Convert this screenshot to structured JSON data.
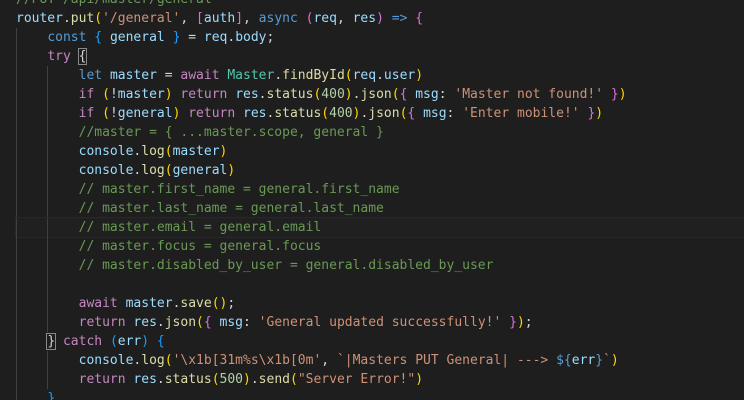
{
  "editor": {
    "language": "javascript",
    "theme_colors": {
      "background": "#1e1e1e",
      "keyword": "#569cd6",
      "control": "#c586c0",
      "function": "#dcdcaa",
      "variable": "#9cdcfe",
      "class": "#4ec9b0",
      "string": "#ce9178",
      "number": "#b5cea8",
      "comment": "#6a9955",
      "bracket_1": "#ffd700",
      "bracket_2": "#da70d6",
      "bracket_3": "#179fff"
    },
    "lines": [
      {
        "indent": 0,
        "current": false,
        "tokens": [
          [
            "com",
            "//PUT /api/master/general"
          ]
        ]
      },
      {
        "indent": 0,
        "current": false,
        "tokens": [
          [
            "var",
            "router"
          ],
          [
            "pun",
            "."
          ],
          [
            "fn",
            "put"
          ],
          [
            "br1",
            "("
          ],
          [
            "str",
            "'/general'"
          ],
          [
            "pun",
            ", "
          ],
          [
            "br2",
            "["
          ],
          [
            "var",
            "auth"
          ],
          [
            "br2",
            "]"
          ],
          [
            "pun",
            ", "
          ],
          [
            "kw",
            "async"
          ],
          [
            "pun",
            " "
          ],
          [
            "br2",
            "("
          ],
          [
            "var",
            "req"
          ],
          [
            "pun",
            ", "
          ],
          [
            "var",
            "res"
          ],
          [
            "br2",
            ")"
          ],
          [
            "pun",
            " "
          ],
          [
            "kw",
            "=>"
          ],
          [
            "pun",
            " "
          ],
          [
            "br2",
            "{"
          ]
        ]
      },
      {
        "indent": 1,
        "current": false,
        "tokens": [
          [
            "kw",
            "const"
          ],
          [
            "pun",
            " "
          ],
          [
            "br3",
            "{"
          ],
          [
            "pun",
            " "
          ],
          [
            "var",
            "general"
          ],
          [
            "pun",
            " "
          ],
          [
            "br3",
            "}"
          ],
          [
            "pun",
            " = "
          ],
          [
            "var",
            "req"
          ],
          [
            "pun",
            "."
          ],
          [
            "var",
            "body"
          ],
          [
            "pun",
            ";"
          ]
        ]
      },
      {
        "indent": 1,
        "current": false,
        "tokens": [
          [
            "ctrl",
            "try"
          ],
          [
            "pun",
            " "
          ],
          [
            "bm",
            "{"
          ]
        ]
      },
      {
        "indent": 2,
        "current": false,
        "tokens": [
          [
            "kw",
            "let"
          ],
          [
            "pun",
            " "
          ],
          [
            "var",
            "master"
          ],
          [
            "pun",
            " = "
          ],
          [
            "ctrl",
            "await"
          ],
          [
            "pun",
            " "
          ],
          [
            "cls",
            "Master"
          ],
          [
            "pun",
            "."
          ],
          [
            "fn",
            "findById"
          ],
          [
            "br1",
            "("
          ],
          [
            "var",
            "req"
          ],
          [
            "pun",
            "."
          ],
          [
            "var",
            "user"
          ],
          [
            "br1",
            ")"
          ]
        ]
      },
      {
        "indent": 2,
        "current": false,
        "tokens": [
          [
            "ctrl",
            "if"
          ],
          [
            "pun",
            " "
          ],
          [
            "br1",
            "("
          ],
          [
            "pun",
            "!"
          ],
          [
            "var",
            "master"
          ],
          [
            "br1",
            ")"
          ],
          [
            "pun",
            " "
          ],
          [
            "ctrl",
            "return"
          ],
          [
            "pun",
            " "
          ],
          [
            "var",
            "res"
          ],
          [
            "pun",
            "."
          ],
          [
            "fn",
            "status"
          ],
          [
            "br1",
            "("
          ],
          [
            "num",
            "400"
          ],
          [
            "br1",
            ")"
          ],
          [
            "pun",
            "."
          ],
          [
            "fn",
            "json"
          ],
          [
            "br1",
            "("
          ],
          [
            "br2",
            "{"
          ],
          [
            "pun",
            " "
          ],
          [
            "var",
            "msg"
          ],
          [
            "pun",
            ": "
          ],
          [
            "str",
            "'Master not found!'"
          ],
          [
            "pun",
            " "
          ],
          [
            "br2",
            "}"
          ],
          [
            "br1",
            ")"
          ]
        ]
      },
      {
        "indent": 2,
        "current": false,
        "tokens": [
          [
            "ctrl",
            "if"
          ],
          [
            "pun",
            " "
          ],
          [
            "br1",
            "("
          ],
          [
            "pun",
            "!"
          ],
          [
            "var",
            "general"
          ],
          [
            "br1",
            ")"
          ],
          [
            "pun",
            " "
          ],
          [
            "ctrl",
            "return"
          ],
          [
            "pun",
            " "
          ],
          [
            "var",
            "res"
          ],
          [
            "pun",
            "."
          ],
          [
            "fn",
            "status"
          ],
          [
            "br1",
            "("
          ],
          [
            "num",
            "400"
          ],
          [
            "br1",
            ")"
          ],
          [
            "pun",
            "."
          ],
          [
            "fn",
            "json"
          ],
          [
            "br1",
            "("
          ],
          [
            "br2",
            "{"
          ],
          [
            "pun",
            " "
          ],
          [
            "var",
            "msg"
          ],
          [
            "pun",
            ": "
          ],
          [
            "str",
            "'Enter mobile!'"
          ],
          [
            "pun",
            " "
          ],
          [
            "br2",
            "}"
          ],
          [
            "br1",
            ")"
          ]
        ]
      },
      {
        "indent": 2,
        "current": false,
        "tokens": [
          [
            "com",
            "//master = { ...master.scope, general }"
          ]
        ]
      },
      {
        "indent": 2,
        "current": false,
        "tokens": [
          [
            "var",
            "console"
          ],
          [
            "pun",
            "."
          ],
          [
            "fn",
            "log"
          ],
          [
            "br1",
            "("
          ],
          [
            "var",
            "master"
          ],
          [
            "br1",
            ")"
          ]
        ]
      },
      {
        "indent": 2,
        "current": false,
        "tokens": [
          [
            "var",
            "console"
          ],
          [
            "pun",
            "."
          ],
          [
            "fn",
            "log"
          ],
          [
            "br1",
            "("
          ],
          [
            "var",
            "general"
          ],
          [
            "br1",
            ")"
          ]
        ]
      },
      {
        "indent": 2,
        "current": false,
        "tokens": [
          [
            "com",
            "// master.first_name = general.first_name"
          ]
        ]
      },
      {
        "indent": 2,
        "current": false,
        "tokens": [
          [
            "com",
            "// master.last_name = general.last_name"
          ]
        ]
      },
      {
        "indent": 2,
        "current": true,
        "tokens": [
          [
            "com",
            "// master.email = general.email"
          ]
        ]
      },
      {
        "indent": 2,
        "current": false,
        "tokens": [
          [
            "com",
            "// master.focus = general.focus"
          ]
        ]
      },
      {
        "indent": 2,
        "current": false,
        "tokens": [
          [
            "com",
            "// master.disabled_by_user = general.disabled_by_user"
          ]
        ]
      },
      {
        "indent": 2,
        "current": false,
        "tokens": []
      },
      {
        "indent": 2,
        "current": false,
        "tokens": [
          [
            "ctrl",
            "await"
          ],
          [
            "pun",
            " "
          ],
          [
            "var",
            "master"
          ],
          [
            "pun",
            "."
          ],
          [
            "fn",
            "save"
          ],
          [
            "br1",
            "("
          ],
          [
            "br1",
            ")"
          ],
          [
            "pun",
            ";"
          ]
        ]
      },
      {
        "indent": 2,
        "current": false,
        "tokens": [
          [
            "ctrl",
            "return"
          ],
          [
            "pun",
            " "
          ],
          [
            "var",
            "res"
          ],
          [
            "pun",
            "."
          ],
          [
            "fn",
            "json"
          ],
          [
            "br1",
            "("
          ],
          [
            "br2",
            "{"
          ],
          [
            "pun",
            " "
          ],
          [
            "var",
            "msg"
          ],
          [
            "pun",
            ": "
          ],
          [
            "str",
            "'General updated successfully!'"
          ],
          [
            "pun",
            " "
          ],
          [
            "br2",
            "}"
          ],
          [
            "br1",
            ")"
          ],
          [
            "pun",
            ";"
          ]
        ]
      },
      {
        "indent": 1,
        "current": false,
        "tokens": [
          [
            "bm",
            "}"
          ],
          [
            "pun",
            " "
          ],
          [
            "ctrl",
            "catch"
          ],
          [
            "pun",
            " "
          ],
          [
            "br3",
            "("
          ],
          [
            "var",
            "err"
          ],
          [
            "br3",
            ")"
          ],
          [
            "pun",
            " "
          ],
          [
            "br3",
            "{"
          ]
        ]
      },
      {
        "indent": 2,
        "current": false,
        "tokens": [
          [
            "var",
            "console"
          ],
          [
            "pun",
            "."
          ],
          [
            "fn",
            "log"
          ],
          [
            "br1",
            "("
          ],
          [
            "str",
            "'\\x1b[31m%s\\x1b[0m'"
          ],
          [
            "pun",
            ", "
          ],
          [
            "str",
            "`|Masters PUT General| ---> "
          ],
          [
            "kw",
            "${"
          ],
          [
            "var",
            "err"
          ],
          [
            "kw",
            "}"
          ],
          [
            "str",
            "`"
          ],
          [
            "br1",
            ")"
          ]
        ]
      },
      {
        "indent": 2,
        "current": false,
        "tokens": [
          [
            "ctrl",
            "return"
          ],
          [
            "pun",
            " "
          ],
          [
            "var",
            "res"
          ],
          [
            "pun",
            "."
          ],
          [
            "fn",
            "status"
          ],
          [
            "br1",
            "("
          ],
          [
            "num",
            "500"
          ],
          [
            "br1",
            ")"
          ],
          [
            "pun",
            "."
          ],
          [
            "fn",
            "send"
          ],
          [
            "br1",
            "("
          ],
          [
            "str",
            "\"Server Error!\""
          ],
          [
            "br1",
            ")"
          ]
        ]
      },
      {
        "indent": 1,
        "current": false,
        "tokens": [
          [
            "br3",
            "}"
          ]
        ]
      }
    ]
  }
}
